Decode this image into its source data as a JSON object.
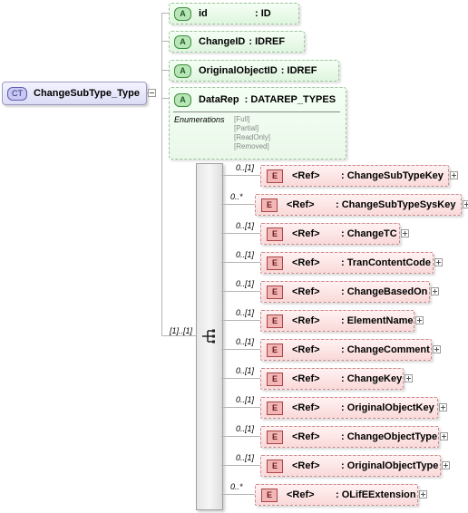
{
  "complex_type": {
    "badge": "CT",
    "name": "ChangeSubType_Type"
  },
  "attributes": [
    {
      "badge": "A",
      "name": "id",
      "type": ": ID"
    },
    {
      "badge": "A",
      "name": "ChangeID",
      "type": ": IDREF"
    },
    {
      "badge": "A",
      "name": "OriginalObjectID",
      "type": ": IDREF"
    },
    {
      "badge": "A",
      "name": "DataRep",
      "type": ": DATAREP_TYPES"
    }
  ],
  "enumerations": {
    "label": "Enumerations",
    "values": [
      "[Full]",
      "[Partial]",
      "[ReadOnly]",
      "[Removed]"
    ]
  },
  "sequence": {
    "occurrence": "[1]..[1]"
  },
  "elements": [
    {
      "badge": "E",
      "occurrence": "0..[1]",
      "ref": "<Ref>",
      "type": ": ChangeSubTypeKey"
    },
    {
      "badge": "E",
      "occurrence": "0..*",
      "ref": "<Ref>",
      "type": ": ChangeSubTypeSysKey"
    },
    {
      "badge": "E",
      "occurrence": "0..[1]",
      "ref": "<Ref>",
      "type": ": ChangeTC"
    },
    {
      "badge": "E",
      "occurrence": "0..[1]",
      "ref": "<Ref>",
      "type": ": TranContentCode"
    },
    {
      "badge": "E",
      "occurrence": "0..[1]",
      "ref": "<Ref>",
      "type": ": ChangeBasedOn"
    },
    {
      "badge": "E",
      "occurrence": "0..[1]",
      "ref": "<Ref>",
      "type": ": ElementName"
    },
    {
      "badge": "E",
      "occurrence": "0..[1]",
      "ref": "<Ref>",
      "type": ": ChangeComment"
    },
    {
      "badge": "E",
      "occurrence": "0..[1]",
      "ref": "<Ref>",
      "type": ": ChangeKey"
    },
    {
      "badge": "E",
      "occurrence": "0..[1]",
      "ref": "<Ref>",
      "type": ": OriginalObjectKey"
    },
    {
      "badge": "E",
      "occurrence": "0..[1]",
      "ref": "<Ref>",
      "type": ": ChangeObjectType"
    },
    {
      "badge": "E",
      "occurrence": "0..[1]",
      "ref": "<Ref>",
      "type": ": OriginalObjectType"
    },
    {
      "badge": "E",
      "occurrence": "0..*",
      "ref": "<Ref>",
      "type": ": OLifEExtension"
    }
  ]
}
